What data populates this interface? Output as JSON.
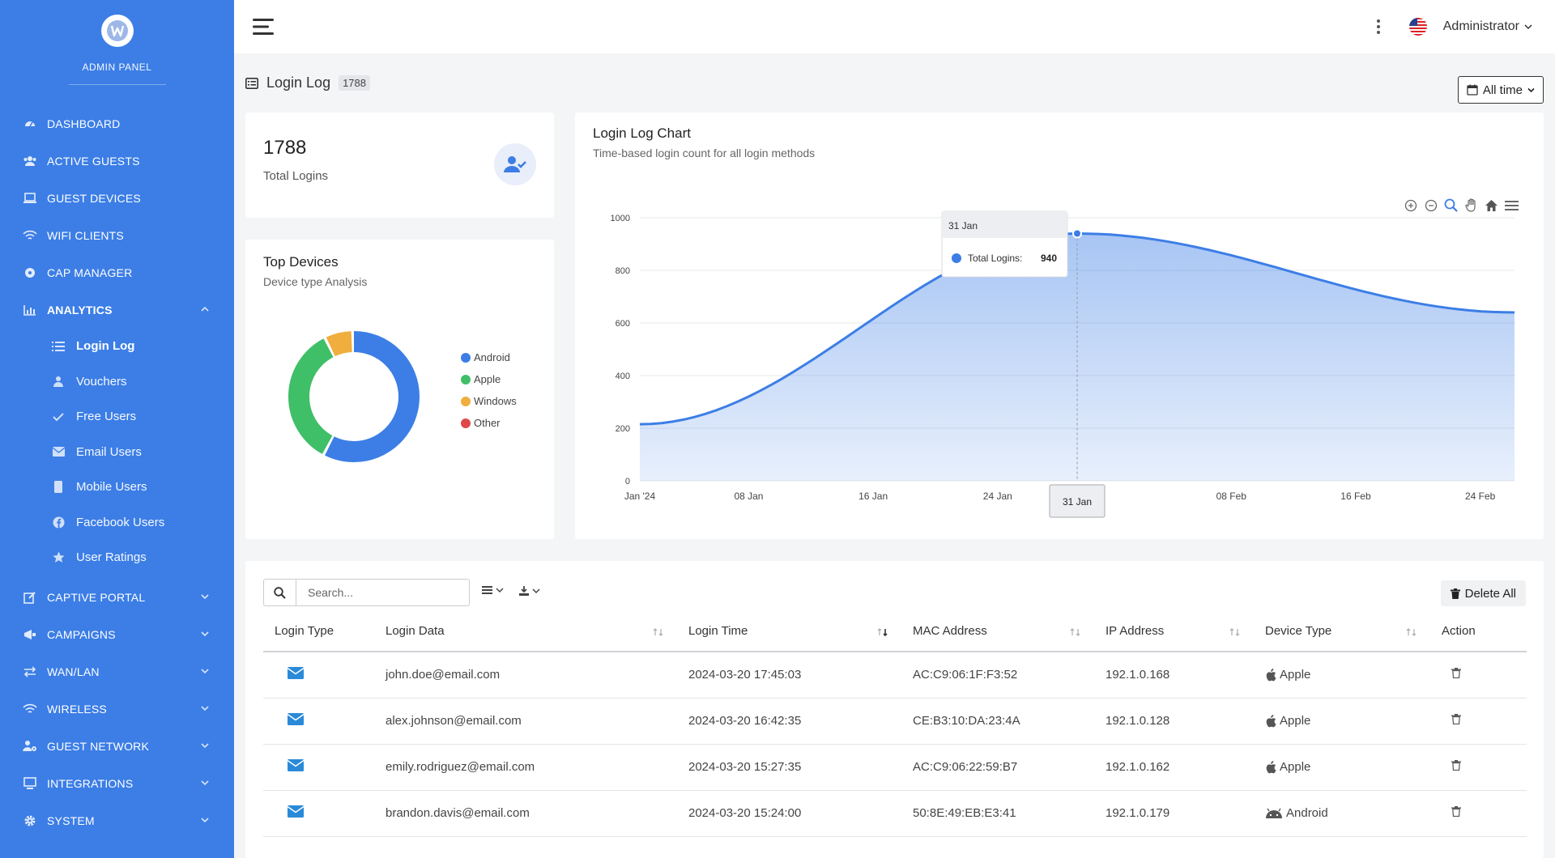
{
  "brand": {
    "title": "ADMIN PANEL"
  },
  "sidebar": {
    "items": [
      {
        "label": "DASHBOARD",
        "icon": "gauge-icon"
      },
      {
        "label": "ACTIVE GUESTS",
        "icon": "users-icon"
      },
      {
        "label": "GUEST DEVICES",
        "icon": "laptop-icon"
      },
      {
        "label": "WIFI CLIENTS",
        "icon": "wifi-icon"
      },
      {
        "label": "CAP MANAGER",
        "icon": "circle-icon"
      },
      {
        "label": "ANALYTICS",
        "icon": "chart-icon",
        "expanded": true
      },
      {
        "label": "CAPTIVE PORTAL",
        "icon": "edit-icon"
      },
      {
        "label": "CAMPAIGNS",
        "icon": "megaphone-icon"
      },
      {
        "label": "WAN/LAN",
        "icon": "arrows-icon"
      },
      {
        "label": "WIRELESS",
        "icon": "wifi-icon"
      },
      {
        "label": "GUEST NETWORK",
        "icon": "user-gear-icon"
      },
      {
        "label": "INTEGRATIONS",
        "icon": "monitor-icon"
      },
      {
        "label": "SYSTEM",
        "icon": "gear-icon"
      }
    ],
    "analytics_sub": [
      {
        "label": "Login Log",
        "icon": "list-icon",
        "active": true
      },
      {
        "label": "Vouchers",
        "icon": "user-icon"
      },
      {
        "label": "Free Users",
        "icon": "check-icon"
      },
      {
        "label": "Email Users",
        "icon": "envelope-icon"
      },
      {
        "label": "Mobile Users",
        "icon": "mobile-icon"
      },
      {
        "label": "Facebook Users",
        "icon": "facebook-icon"
      },
      {
        "label": "User Ratings",
        "icon": "star-icon"
      }
    ]
  },
  "topbar": {
    "user": "Administrator"
  },
  "page": {
    "title": "Login Log",
    "count": "1788",
    "range": "All time"
  },
  "total": {
    "value": "1788",
    "label": "Total Logins"
  },
  "devices": {
    "title": "Top Devices",
    "subtitle": "Device type Analysis",
    "legend": [
      {
        "name": "Android",
        "color": "#3c7ee6",
        "value": 58
      },
      {
        "name": "Apple",
        "color": "#3fbf68",
        "value": 35
      },
      {
        "name": "Windows",
        "color": "#f0ae3e",
        "value": 7
      },
      {
        "name": "Other",
        "color": "#e04848",
        "value": 0
      }
    ]
  },
  "chart_data": {
    "type": "area",
    "title": "Login Log Chart",
    "subtitle": "Time-based login count for all login methods",
    "x_ticks": [
      "Jan '24",
      "08 Jan",
      "16 Jan",
      "24 Jan",
      "31 Jan",
      "08 Feb",
      "16 Feb",
      "24 Feb"
    ],
    "y_ticks": [
      "0",
      "200",
      "400",
      "600",
      "800",
      "1000"
    ],
    "ylim": [
      0,
      1000
    ],
    "series": [
      {
        "name": "Total Logins",
        "points": [
          {
            "x": "2024-01-01",
            "y": 215
          },
          {
            "x": "2024-01-31",
            "y": 940
          },
          {
            "x": "2024-03-01",
            "y": 640
          }
        ]
      }
    ],
    "tooltip": {
      "x": "31 Jan",
      "label": "Total Logins:",
      "value": "940"
    },
    "crosshair_label": "31 Jan"
  },
  "table": {
    "search_placeholder": "Search...",
    "delete_all": "Delete All",
    "columns": [
      "Login Type",
      "Login Data",
      "Login Time",
      "MAC Address",
      "IP Address",
      "Device Type",
      "Action"
    ],
    "rows": [
      {
        "type": "envelope-icon",
        "data": "john.doe@email.com",
        "time": "2024-03-20 17:45:03",
        "mac": "AC:C9:06:1F:F3:52",
        "ip": "192.1.0.168",
        "device": "Apple"
      },
      {
        "type": "envelope-icon",
        "data": "alex.johnson@email.com",
        "time": "2024-03-20 16:42:35",
        "mac": "CE:B3:10:DA:23:4A",
        "ip": "192.1.0.128",
        "device": "Apple"
      },
      {
        "type": "envelope-icon",
        "data": "emily.rodriguez@email.com",
        "time": "2024-03-20 15:27:35",
        "mac": "AC:C9:06:22:59:B7",
        "ip": "192.1.0.162",
        "device": "Apple"
      },
      {
        "type": "envelope-icon",
        "data": "brandon.davis@email.com",
        "time": "2024-03-20 15:24:00",
        "mac": "50:8E:49:EB:E3:41",
        "ip": "192.1.0.179",
        "device": "Android"
      }
    ]
  }
}
